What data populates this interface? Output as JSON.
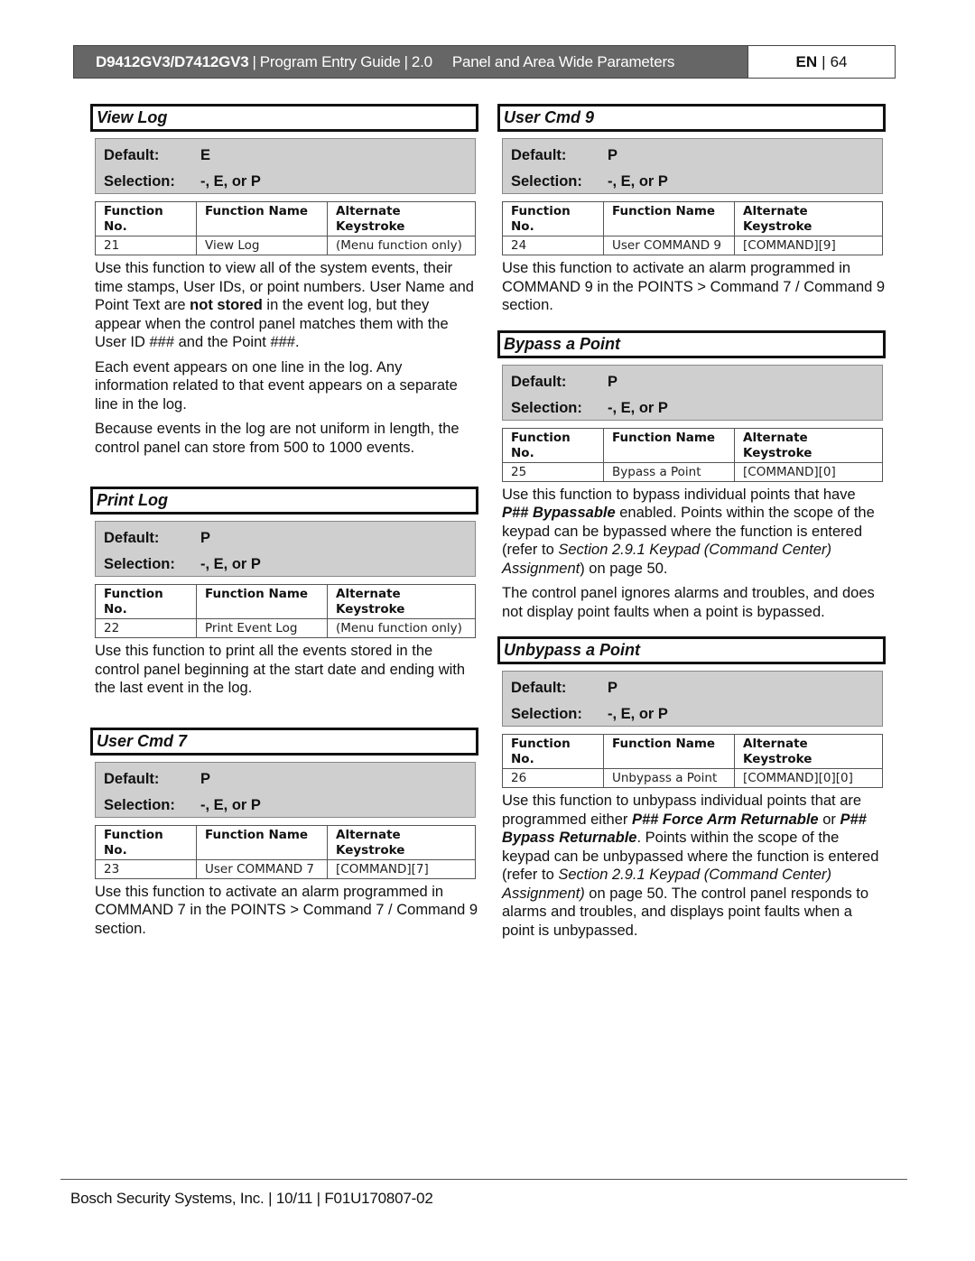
{
  "header": {
    "model": "D9412GV3/D7412GV3",
    "separator": "|",
    "guide": "Program Entry Guide",
    "version": "2.0",
    "section": "Panel and Area Wide Parameters",
    "language": "EN",
    "page": "64"
  },
  "table_headers": {
    "col1_line1": "Function",
    "col1_line2": "No.",
    "col2": "Function Name",
    "col3_line1": "Alternate",
    "col3_line2": "Keystroke"
  },
  "labels": {
    "default": "Default:",
    "selection": "Selection:"
  },
  "sections": {
    "view_log": {
      "title": "View Log",
      "default": "E",
      "selection": "-, E, or P",
      "function_no": "21",
      "function_name": "View Log",
      "keystroke": "(Menu function only)",
      "p1_a": "Use this function to view all of the system events, their time stamps, User IDs, or point numbers. User Name and Point Text are ",
      "p1_b": "not stored",
      "p1_c": " in the event log, but they appear when the control panel matches them with the User ID ### and the Point ###.",
      "p2": "Each event appears on one line in the log. Any information related to that event appears on a separate line in the log.",
      "p3": "Because events in the log are not uniform in length, the control panel can store from 500 to 1000 events."
    },
    "print_log": {
      "title": "Print Log",
      "default": "P",
      "selection": "-, E, or P",
      "function_no": "22",
      "function_name": "Print Event Log",
      "keystroke": "(Menu function only)",
      "p1": "Use this function to print all the events stored in the control panel beginning at the start date and ending with the last event in the log."
    },
    "user_cmd_7": {
      "title": "User Cmd 7",
      "default": "P",
      "selection": "-, E, or P",
      "function_no": "23",
      "function_name": "User COMMAND 7",
      "keystroke": "[COMMAND][7]",
      "p1": "Use this function to activate an alarm programmed in COMMAND 7 in the POINTS > Command 7 / Command 9 section."
    },
    "user_cmd_9": {
      "title": "User Cmd 9",
      "default": "P",
      "selection": "-, E, or P",
      "function_no": "24",
      "function_name": "User COMMAND 9",
      "keystroke": "[COMMAND][9]",
      "p1": "Use this function to activate an alarm programmed in COMMAND 9 in the POINTS > Command 7 / Command 9 section."
    },
    "bypass_point": {
      "title": "Bypass a Point",
      "default": "P",
      "selection": "-, E, or P",
      "function_no": "25",
      "function_name": "Bypass a Point",
      "keystroke": "[COMMAND][0]",
      "p1_a": "Use this function to bypass individual points that have ",
      "p1_b": "P## Bypassable",
      "p1_c": " enabled. Points within the scope of the keypad can be bypassed where the function is entered (refer to ",
      "p1_d": "Section 2.9.1 Keypad (Command Center) Assignment",
      "p1_e": ") on page 50.",
      "p2": "The control panel ignores alarms and troubles, and does not display point faults when a point is bypassed."
    },
    "unbypass_point": {
      "title": "Unbypass a Point",
      "default": "P",
      "selection": "-, E, or P",
      "function_no": "26",
      "function_name": "Unbypass a Point",
      "keystroke": "[COMMAND][0][0]",
      "p1_a": "Use this function to unbypass individual points that are programmed either ",
      "p1_b": "P## Force Arm Returnable",
      "p1_c": " or ",
      "p1_d": "P## Bypass Returnable",
      "p1_e": ". Points within the scope of the keypad can be unbypassed where the function is entered (refer to ",
      "p1_f": "Section 2.9.1 Keypad (Command Center) Assignment)",
      "p1_g": " on page 50. The control panel responds to alarms and troubles, and displays point faults when a point is unbypassed."
    }
  },
  "footer": {
    "company": "Bosch Security Systems, Inc.",
    "date": "10/11",
    "doc_number": "F01U170807-02",
    "separator": "|"
  },
  "colors": {
    "header_bar": "#666666",
    "param_box": "#cfcfcf"
  }
}
